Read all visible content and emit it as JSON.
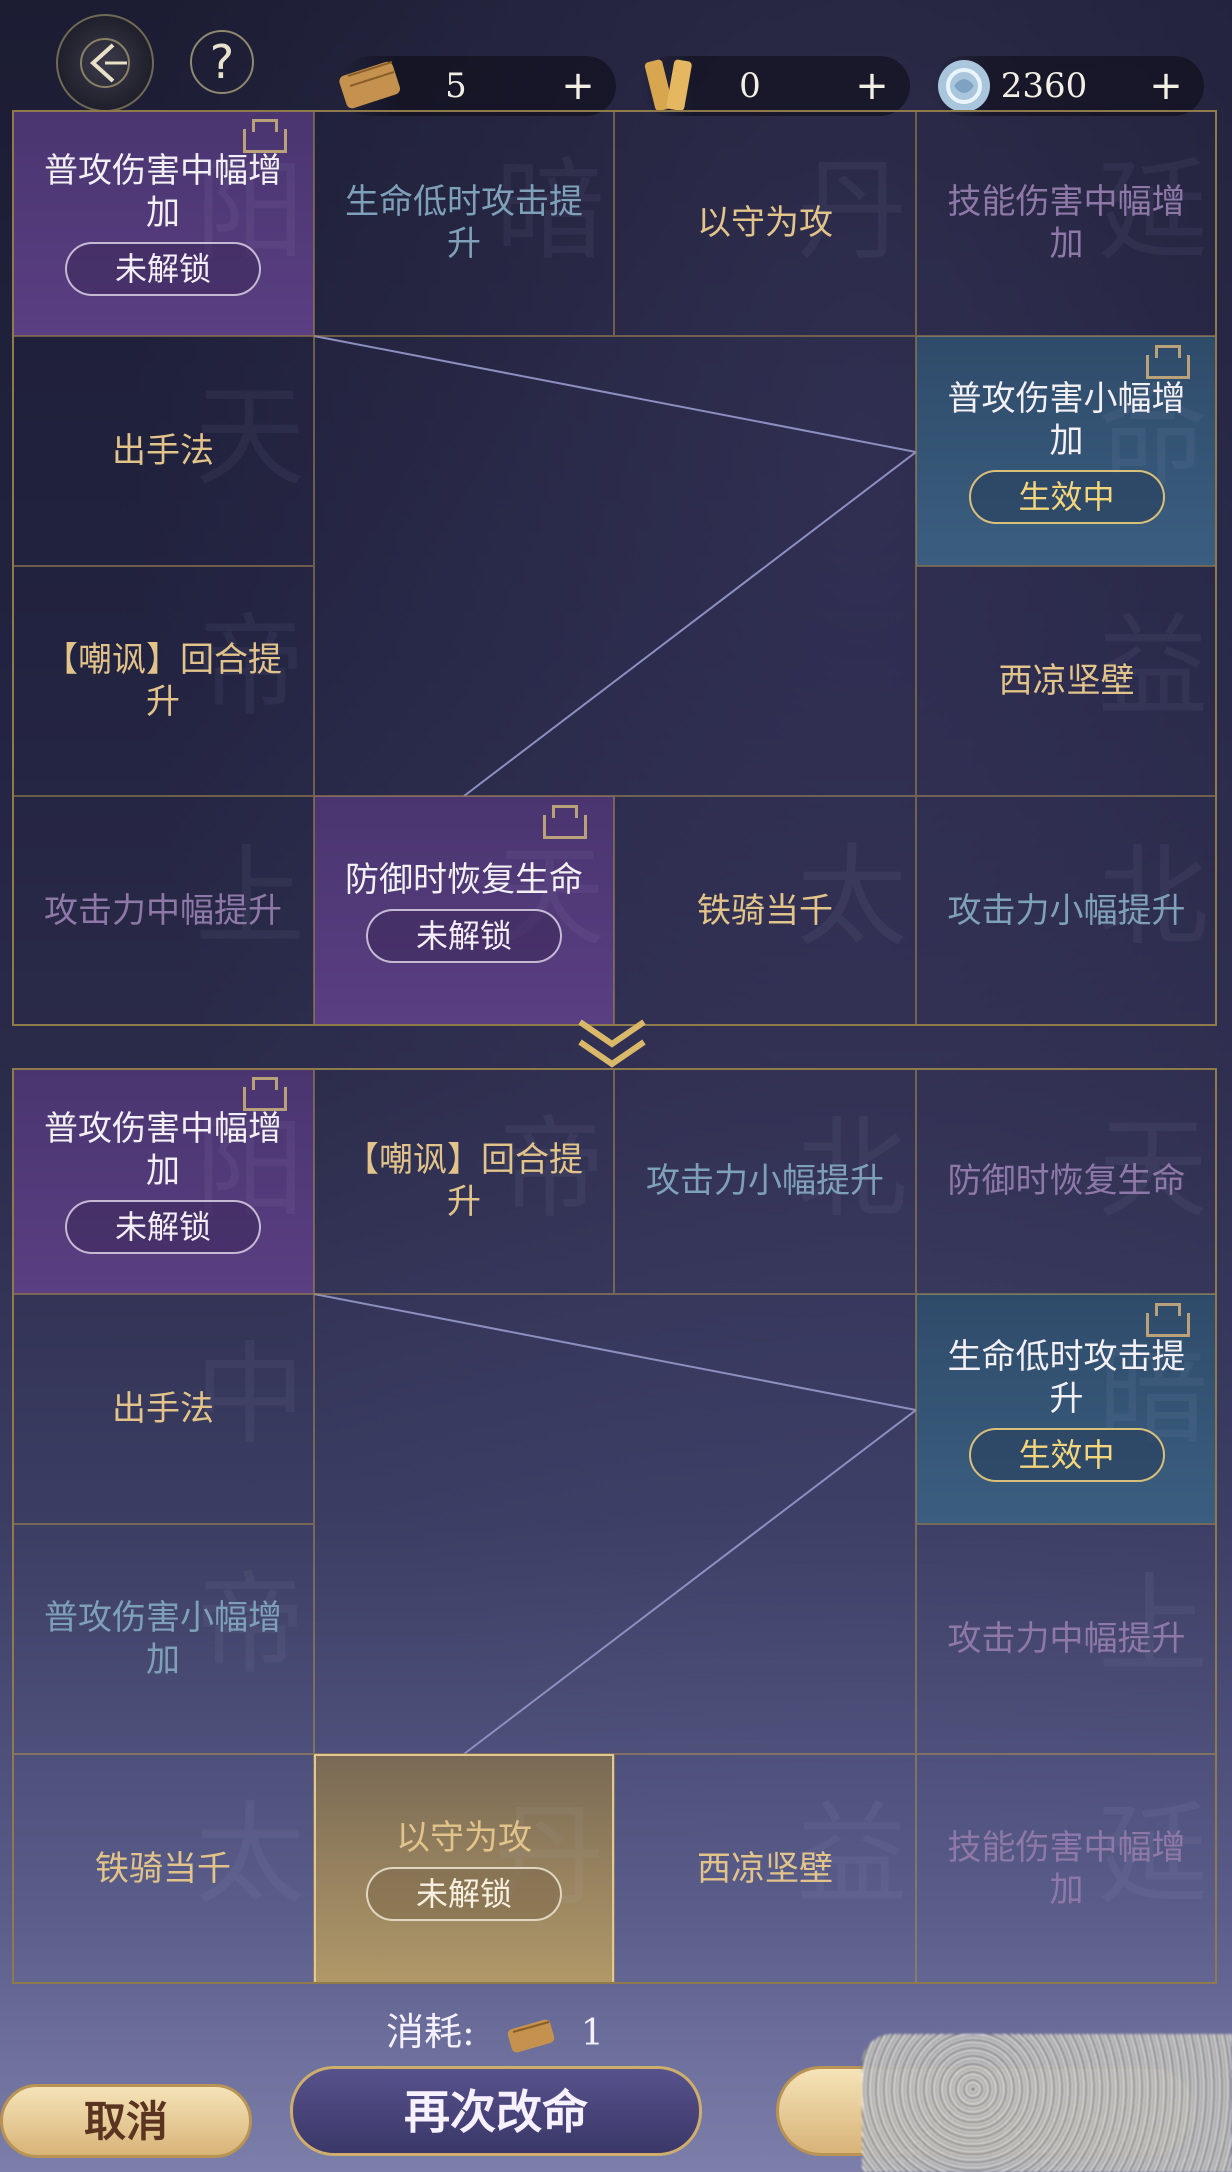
{
  "top_bar": {
    "resources": [
      {
        "icon": "scroll-icon",
        "value": "5"
      },
      {
        "icon": "tablet-icon",
        "value": "0"
      },
      {
        "icon": "jade-coin-icon",
        "value": "2360"
      }
    ],
    "plus": "+",
    "help": "?"
  },
  "upper_board": {
    "cells": [
      {
        "label": "普攻伤害中幅增加",
        "style": "purple",
        "badge": "未解锁",
        "bg": "阳"
      },
      {
        "label": "生命低时攻击提升",
        "style": "dimblue",
        "bg": "暗"
      },
      {
        "label": "以守为攻",
        "style": "gold",
        "bg": "丹"
      },
      {
        "label": "技能伤害中幅增加",
        "style": "dimpurple",
        "bg": "延"
      },
      {
        "label": "出手法",
        "style": "gold",
        "bg": "天"
      },
      {
        "label": "普攻伤害小幅增加",
        "style": "blue",
        "badge": "生效中",
        "bg": "命"
      },
      {
        "label": "【嘲讽】回合提升",
        "style": "gold",
        "bg": "帝"
      },
      {
        "label": "西凉坚壁",
        "style": "gold",
        "bg": "益"
      },
      {
        "label": "攻击力中幅提升",
        "style": "dimpurple",
        "bg": "上"
      },
      {
        "label": "防御时恢复生命",
        "style": "purple",
        "badge": "未解锁",
        "bg": "天"
      },
      {
        "label": "铁骑当千",
        "style": "gold",
        "bg": "太"
      },
      {
        "label": "攻击力小幅提升",
        "style": "dimblue",
        "bg": "北"
      }
    ]
  },
  "lower_board": {
    "cells": [
      {
        "label": "普攻伤害中幅增加",
        "style": "purple",
        "badge": "未解锁",
        "bg": "阳"
      },
      {
        "label": "【嘲讽】回合提升",
        "style": "gold",
        "bg": "帝"
      },
      {
        "label": "攻击力小幅提升",
        "style": "dimblue",
        "bg": "北"
      },
      {
        "label": "防御时恢复生命",
        "style": "dimpurple",
        "bg": "天"
      },
      {
        "label": "出手法",
        "style": "gold",
        "bg": "中"
      },
      {
        "label": "生命低时攻击提升",
        "style": "blue",
        "badge": "生效中",
        "bg": "暗"
      },
      {
        "label": "普攻伤害小幅增加",
        "style": "dimblue",
        "bg": "帝"
      },
      {
        "label": "攻击力中幅提升",
        "style": "dimpurple",
        "bg": "上"
      },
      {
        "label": "铁骑当千",
        "style": "gold",
        "bg": "太"
      },
      {
        "label": "以守为攻",
        "style": "goldbox",
        "badge": "未解锁",
        "bg": "丹"
      },
      {
        "label": "西凉坚壁",
        "style": "gold",
        "bg": "益"
      },
      {
        "label": "技能伤害中幅增加",
        "style": "dimpurple",
        "bg": "延"
      }
    ]
  },
  "footer": {
    "cost_label": "消耗:",
    "cost_value": "1",
    "cancel": "取消",
    "again": "再次改命"
  },
  "colors": {
    "gold_text": "#e2c48a",
    "purple_cell": "#4a3570",
    "blue_cell": "#2f4b6a",
    "frame": "#8e7a4a"
  }
}
